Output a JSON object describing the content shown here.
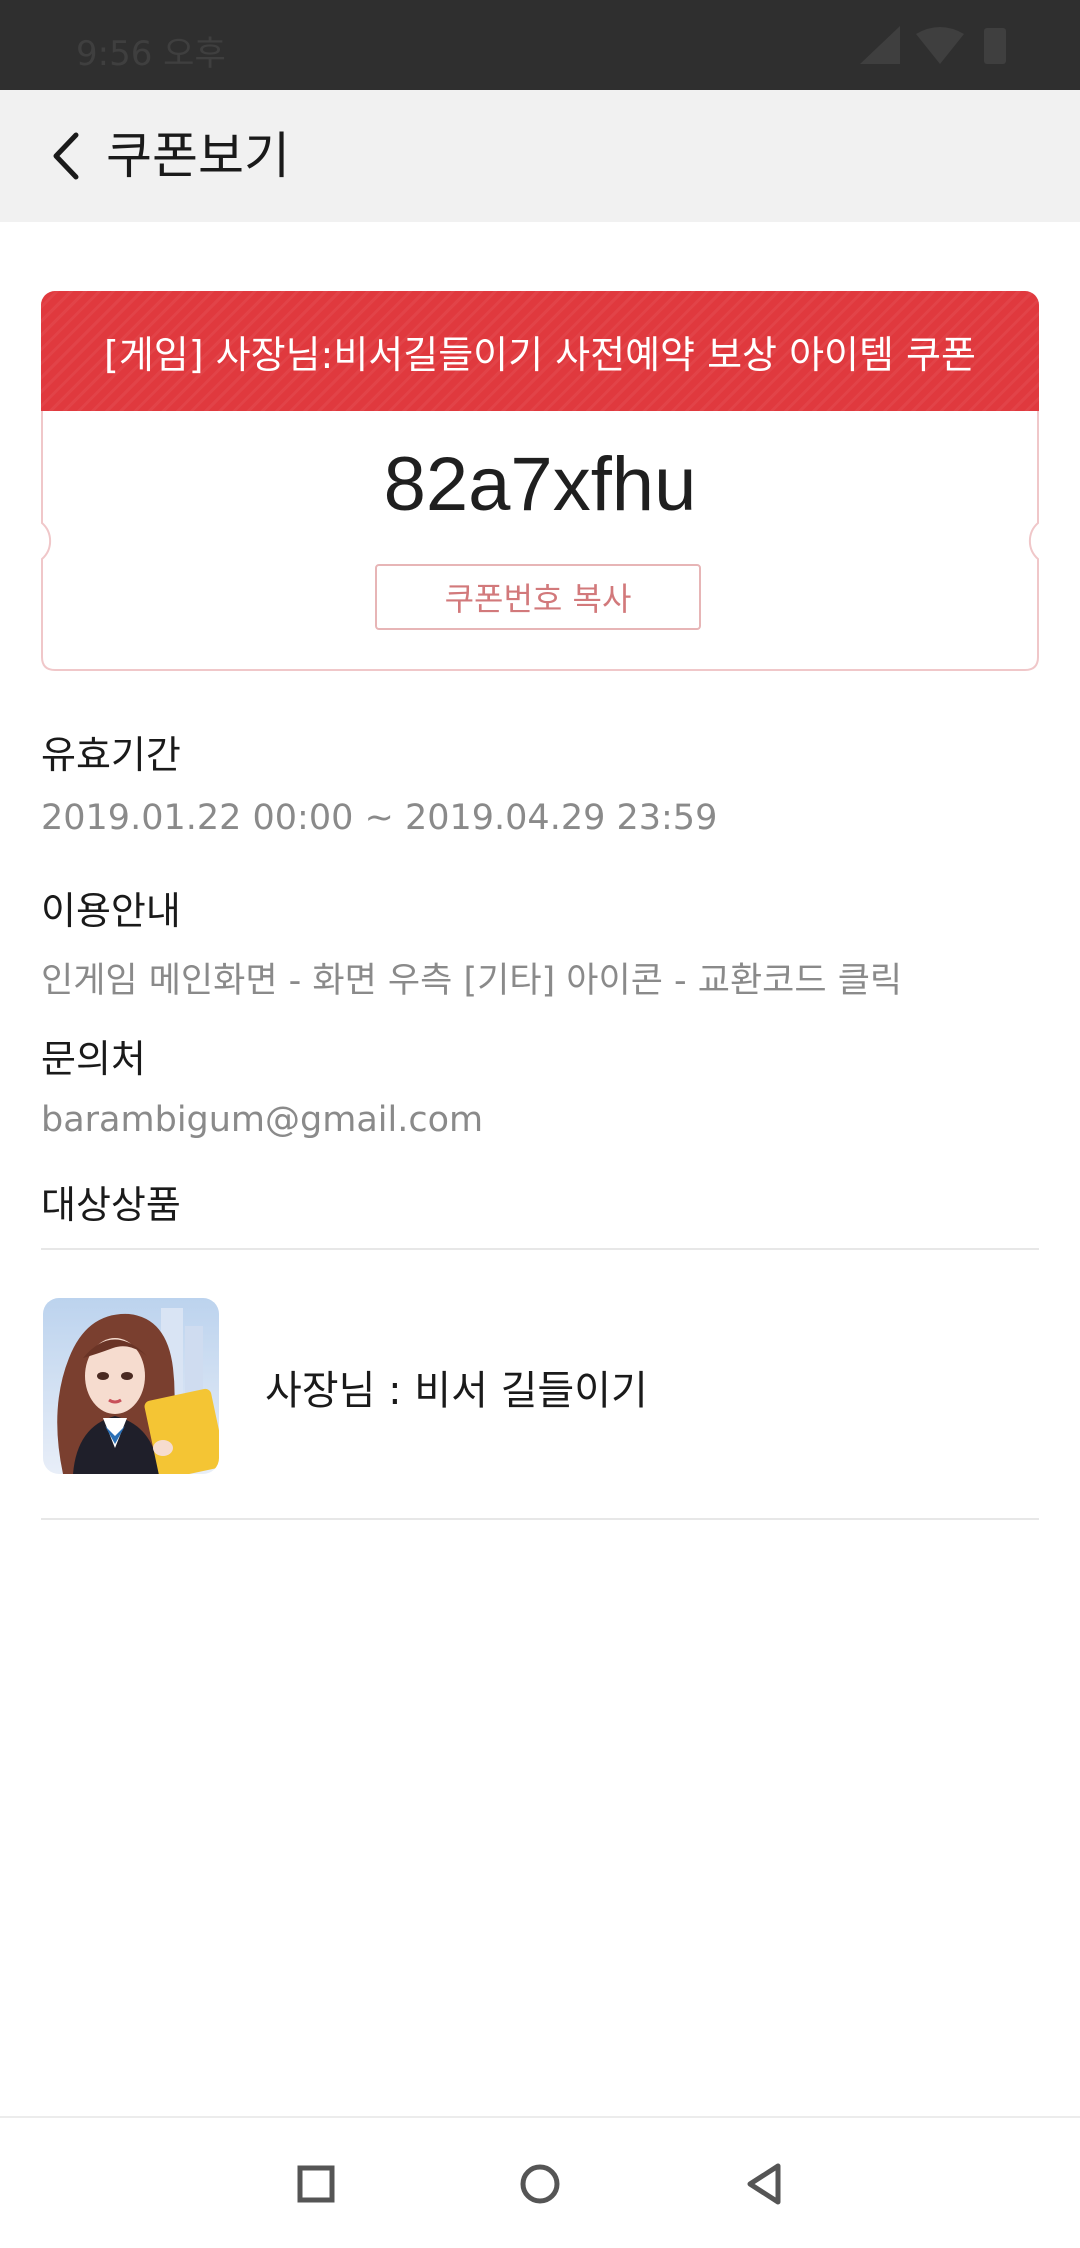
{
  "status_bar": {
    "time": "9:56 오후"
  },
  "header": {
    "back_icon": "chevron-left-icon",
    "title": "쿠폰보기"
  },
  "coupon": {
    "title": "[게임] 사장님:비서길들이기 사전예약 보상 아이템 쿠폰",
    "code": "82a7xfhu",
    "copy_label": "쿠폰번호 복사",
    "accent_color": "#e0393e"
  },
  "details": {
    "validity_label": "유효기간",
    "validity_value": "2019.01.22 00:00 ~ 2019.04.29 23:59",
    "usage_label": "이용안내",
    "usage_value": "인게임 메인화면 - 화면 우측 [기타] 아이콘 - 교환코드 클릭",
    "contact_label": "문의처",
    "contact_value": "barambigum@gmail.com",
    "product_label": "대상상품"
  },
  "product": {
    "name": "사장님 : 비서 길들이기"
  },
  "nav": {
    "recent_icon": "square-icon",
    "home_icon": "circle-icon",
    "back_icon": "triangle-back-icon"
  }
}
